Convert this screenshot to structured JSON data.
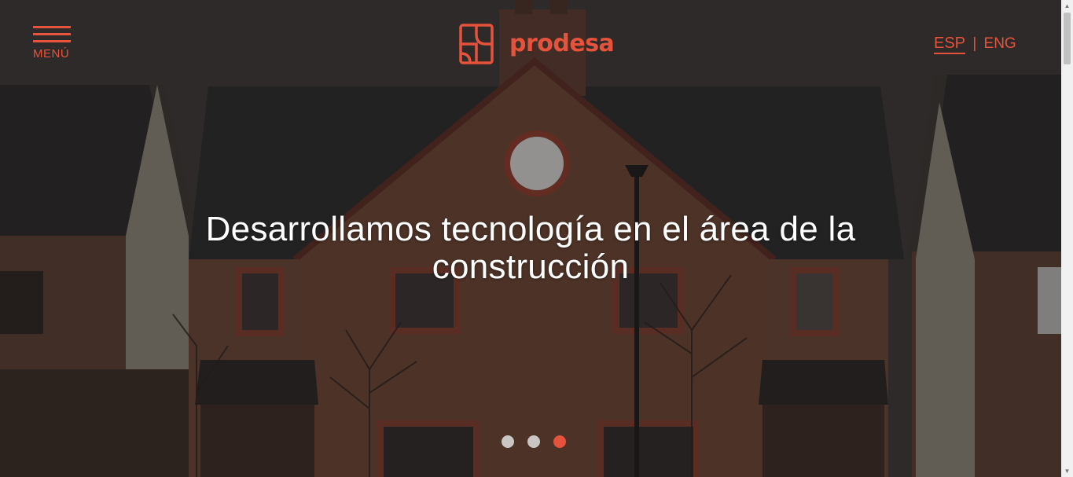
{
  "header": {
    "menu_label": "MENÚ",
    "logo_text": "prodesa",
    "lang_active": "ESP",
    "lang_separator": "|",
    "lang_other": "ENG"
  },
  "hero": {
    "headline": "Desarrollamos tecnología en el área de la construcción",
    "slides_total": 3,
    "active_slide": 3
  },
  "icons": {
    "menu": "hamburger-icon",
    "logo": "prodesa-logo-mark",
    "scroll_up": "chevron-up-icon",
    "scroll_down": "chevron-down-icon"
  },
  "colors": {
    "accent": "#e5533d",
    "headline": "#ffffff",
    "dot_inactive": "#c9c6c3"
  }
}
